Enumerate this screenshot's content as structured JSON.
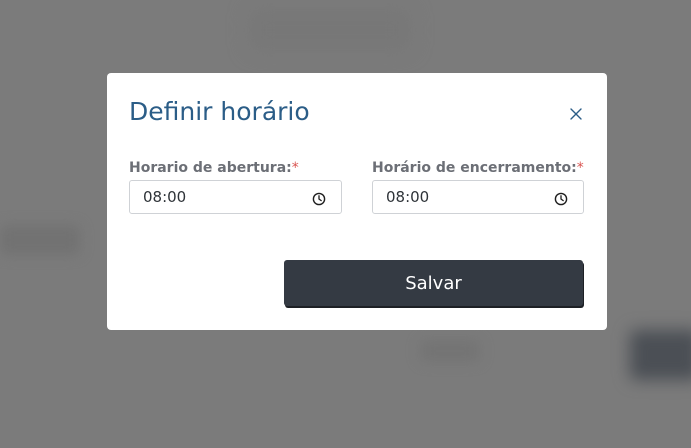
{
  "modal": {
    "title": "Definir horário",
    "close_icon": "close-icon",
    "fields": [
      {
        "label": "Horario de abertura:",
        "required_mark": "*",
        "value": "08:00",
        "icon": "clock-icon"
      },
      {
        "label": "Horário de encerramento:",
        "required_mark": "*",
        "value": "08:00",
        "icon": "clock-icon"
      }
    ],
    "save_label": "Salvar"
  },
  "colors": {
    "title": "#2b5d87",
    "button": "#343a43",
    "required": "#d9534f",
    "overlay": "#7b7b7b"
  }
}
